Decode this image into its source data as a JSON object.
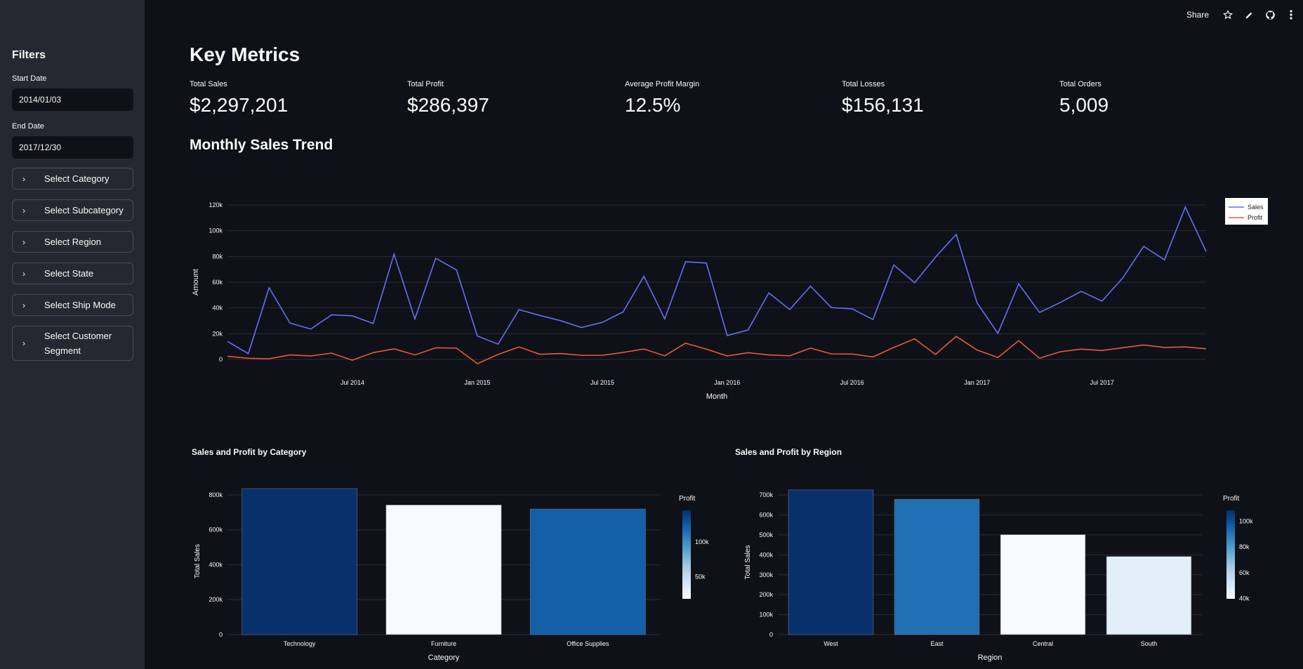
{
  "sidebar": {
    "title": "Filters",
    "start_date": {
      "label": "Start Date",
      "value": "2014/01/03"
    },
    "end_date": {
      "label": "End Date",
      "value": "2017/12/30"
    },
    "expanders": [
      {
        "label": "Select Category"
      },
      {
        "label": "Select Subcategory"
      },
      {
        "label": "Select Region"
      },
      {
        "label": "Select State"
      },
      {
        "label": "Select Ship Mode"
      },
      {
        "label": "Select Customer Segment"
      }
    ]
  },
  "topbar": {
    "share": "Share",
    "icons": [
      "star-icon",
      "pencil-icon",
      "github-icon",
      "more-icon"
    ]
  },
  "main": {
    "title": "Key Metrics",
    "metrics": [
      {
        "label": "Total Sales",
        "value": "$2,297,201"
      },
      {
        "label": "Total Profit",
        "value": "$286,397"
      },
      {
        "label": "Average Profit Margin",
        "value": "12.5%"
      },
      {
        "label": "Total Losses",
        "value": "$156,131"
      },
      {
        "label": "Total Orders",
        "value": "5,009"
      }
    ],
    "trend_title": "Monthly Sales Trend"
  },
  "colors": {
    "sales": "#636efa",
    "profit": "#ef553b",
    "bg": "#0e1117",
    "sidebar": "#262730"
  },
  "chart_data": [
    {
      "type": "line",
      "title": "",
      "xlabel": "Month",
      "ylabel": "Amount",
      "ylim": [
        0,
        120000
      ],
      "yticks": [
        0,
        20000,
        40000,
        60000,
        80000,
        100000,
        120000
      ],
      "ytick_labels": [
        "0",
        "20k",
        "40k",
        "60k",
        "80k",
        "100k",
        "120k"
      ],
      "xtick_labels": [
        "Jul 2014",
        "Jan 2015",
        "Jul 2015",
        "Jan 2016",
        "Jul 2016",
        "Jan 2017",
        "Jul 2017"
      ],
      "legend": "top-right",
      "x": [
        "2014-01",
        "2014-02",
        "2014-03",
        "2014-04",
        "2014-05",
        "2014-06",
        "2014-07",
        "2014-08",
        "2014-09",
        "2014-10",
        "2014-11",
        "2014-12",
        "2015-01",
        "2015-02",
        "2015-03",
        "2015-04",
        "2015-05",
        "2015-06",
        "2015-07",
        "2015-08",
        "2015-09",
        "2015-10",
        "2015-11",
        "2015-12",
        "2016-01",
        "2016-02",
        "2016-03",
        "2016-04",
        "2016-05",
        "2016-06",
        "2016-07",
        "2016-08",
        "2016-09",
        "2016-10",
        "2016-11",
        "2016-12",
        "2017-01",
        "2017-02",
        "2017-03",
        "2017-04",
        "2017-05",
        "2017-06",
        "2017-07",
        "2017-08",
        "2017-09",
        "2017-10",
        "2017-11",
        "2017-12"
      ],
      "series": [
        {
          "name": "Sales",
          "values": [
            14000,
            4500,
            55700,
            28300,
            23600,
            34600,
            33900,
            27900,
            81800,
            31500,
            78600,
            69500,
            18200,
            11900,
            38700,
            34200,
            30100,
            24800,
            28800,
            36900,
            64600,
            31500,
            75900,
            74900,
            18500,
            22900,
            51700,
            38800,
            56900,
            40300,
            39300,
            31000,
            73400,
            59600,
            79400,
            97200,
            43900,
            20300,
            58700,
            36500,
            44300,
            52900,
            45300,
            63400,
            87900,
            77400,
            118400,
            83800
          ]
        },
        {
          "name": "Profit",
          "values": [
            2400,
            900,
            500,
            3500,
            2700,
            4900,
            -600,
            5300,
            8200,
            3500,
            9000,
            8800,
            -3300,
            3900,
            9700,
            4000,
            4600,
            3200,
            3200,
            5400,
            8100,
            2800,
            12600,
            8000,
            2700,
            5200,
            3500,
            2800,
            8800,
            4300,
            4200,
            1900,
            9300,
            16000,
            3900,
            17900,
            7300,
            1500,
            14600,
            900,
            6000,
            8000,
            6900,
            9100,
            11200,
            9300,
            9700,
            8300
          ]
        }
      ]
    },
    {
      "type": "bar",
      "title": "Sales and Profit by Category",
      "xlabel": "Category",
      "ylabel": "Total Sales",
      "ylim": [
        0,
        840000
      ],
      "yticks": [
        0,
        200000,
        400000,
        600000,
        800000
      ],
      "ytick_labels": [
        "0",
        "200k",
        "400k",
        "600k",
        "800k"
      ],
      "categories": [
        "Technology",
        "Furniture",
        "Office Supplies"
      ],
      "values": [
        836154,
        741999,
        719047
      ],
      "profit": [
        145455,
        18451,
        122491
      ],
      "colorbar": {
        "title": "Profit",
        "min": 18451,
        "max": 145455,
        "ticks": [
          50000,
          100000
        ],
        "tick_labels": [
          "50k",
          "100k"
        ]
      }
    },
    {
      "type": "bar",
      "title": "Sales and Profit by Region",
      "xlabel": "Region",
      "ylabel": "Total Sales",
      "ylim": [
        0,
        725000
      ],
      "yticks": [
        0,
        100000,
        200000,
        300000,
        400000,
        500000,
        600000,
        700000
      ],
      "ytick_labels": [
        "0",
        "100k",
        "200k",
        "300k",
        "400k",
        "500k",
        "600k",
        "700k"
      ],
      "categories": [
        "West",
        "East",
        "Central",
        "South"
      ],
      "values": [
        725458,
        678781,
        501240,
        391722
      ],
      "profit": [
        108418,
        91523,
        39706,
        46749
      ],
      "colorbar": {
        "title": "Profit",
        "min": 39706,
        "max": 108418,
        "ticks": [
          40000,
          60000,
          80000,
          100000
        ],
        "tick_labels": [
          "40k",
          "60k",
          "80k",
          "100k"
        ]
      }
    }
  ]
}
